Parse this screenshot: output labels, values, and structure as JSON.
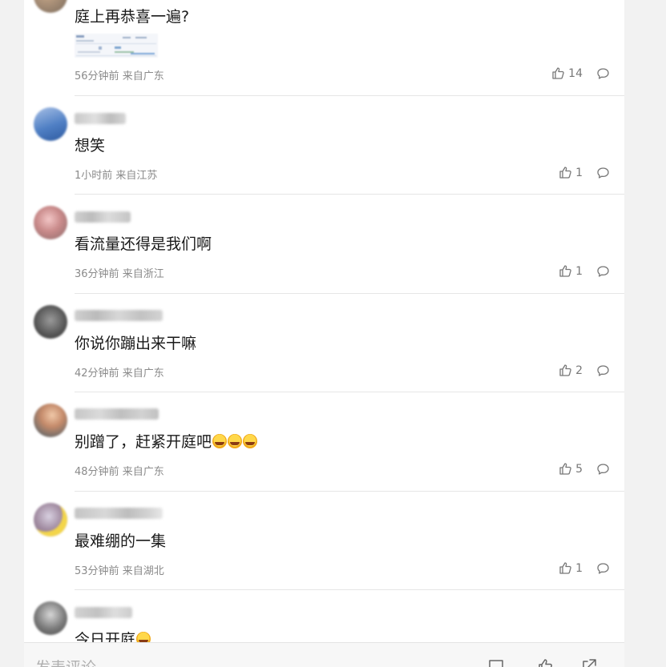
{
  "comments": [
    {
      "text": "庭上再恭喜一遍?",
      "time": "56分钟前",
      "location": "来自广东",
      "likes": "14"
    },
    {
      "text": "想笑",
      "time": "1小时前",
      "location": "来自江苏",
      "likes": "1"
    },
    {
      "text": "看流量还得是我们啊",
      "time": "36分钟前",
      "location": "来自浙江",
      "likes": "1"
    },
    {
      "text": "你说你蹦出来干嘛",
      "time": "42分钟前",
      "location": "来自广东",
      "likes": "2"
    },
    {
      "text": "别蹭了，赶紧开庭吧",
      "time": "48分钟前",
      "location": "来自广东",
      "likes": "5"
    },
    {
      "text": "最难绷的一集",
      "time": "53分钟前",
      "location": "来自湖北",
      "likes": "1"
    },
    {
      "text": "今日开庭"
    }
  ],
  "composer": {
    "placeholder": "发表评论"
  },
  "colors": {
    "accent_meta": "#8a8a8a",
    "divider": "#e6e6e6"
  }
}
